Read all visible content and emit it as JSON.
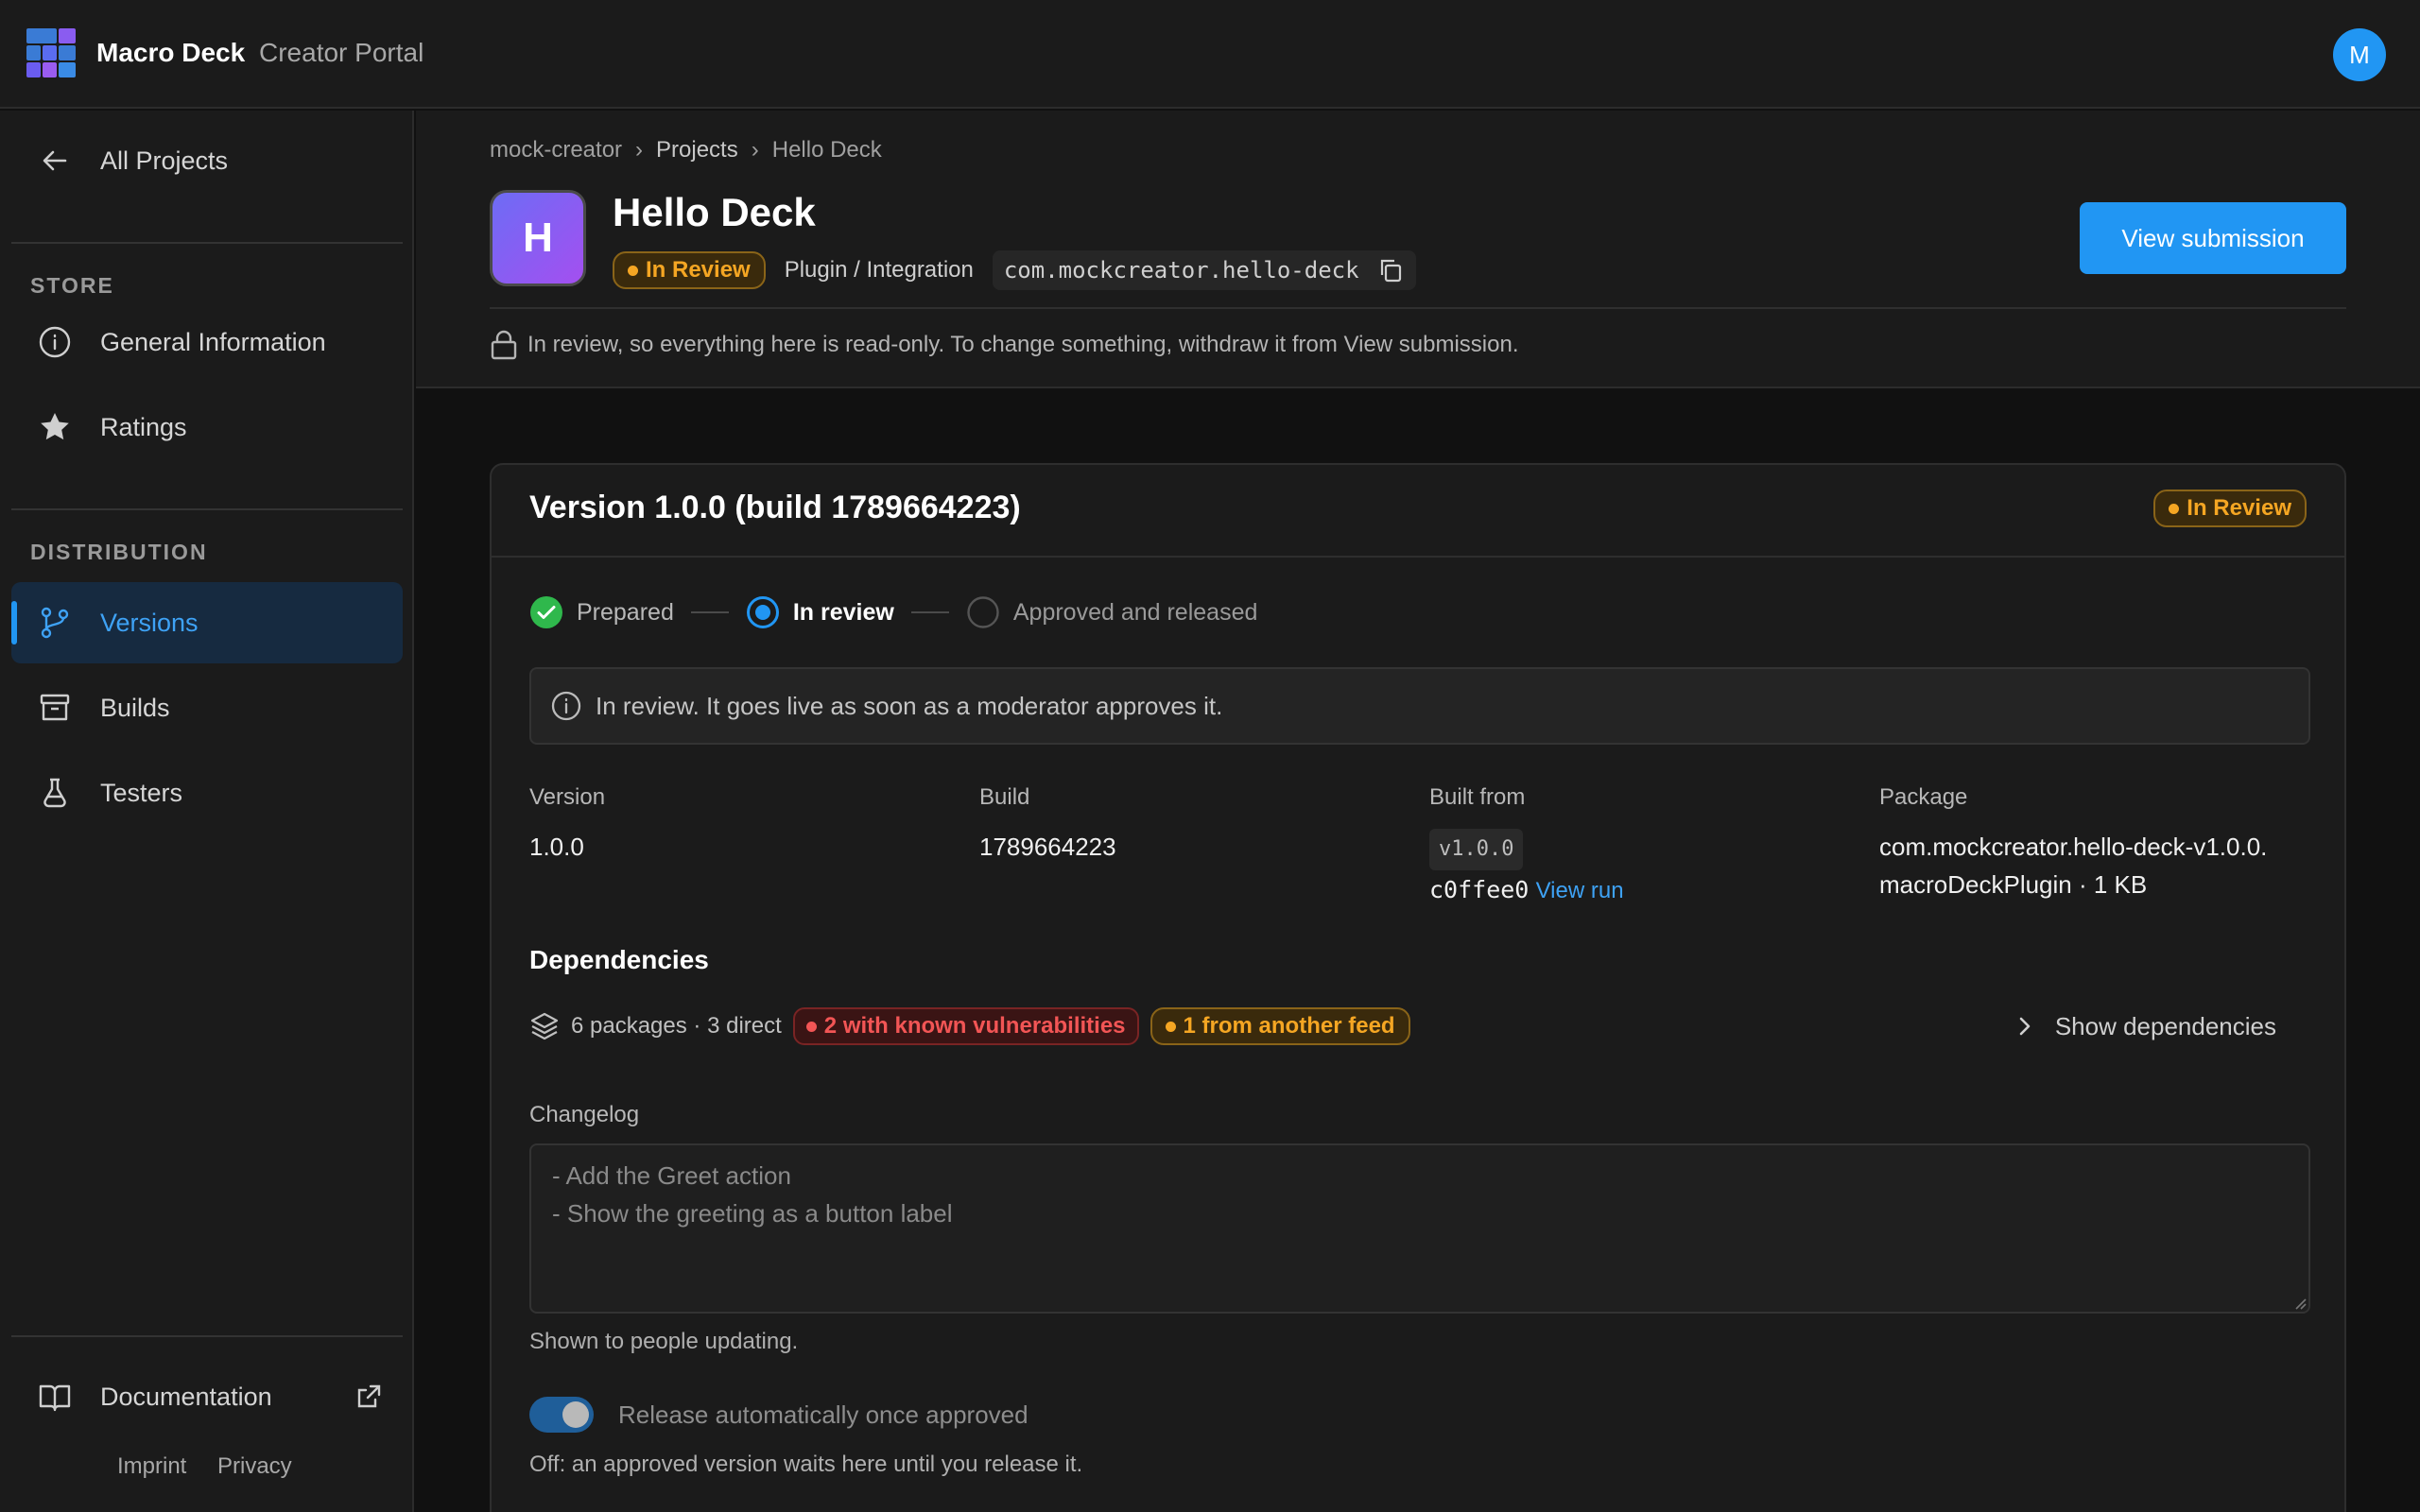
{
  "app": {
    "brand": "Macro Deck",
    "brand_sub": "Creator Portal",
    "avatar_initial": "M",
    "accent": "#2196f3"
  },
  "sidebar": {
    "back_label": "All Projects",
    "store_heading": "STORE",
    "store_items": [
      {
        "label": "General Information",
        "icon": "info-icon"
      },
      {
        "label": "Ratings",
        "icon": "star-icon"
      }
    ],
    "distribution_heading": "DISTRIBUTION",
    "distribution_items": [
      {
        "label": "Versions",
        "icon": "branch-icon",
        "active": true
      },
      {
        "label": "Builds",
        "icon": "archive-icon"
      },
      {
        "label": "Testers",
        "icon": "flask-icon"
      }
    ],
    "docs_label": "Documentation",
    "imprint": "Imprint",
    "privacy": "Privacy"
  },
  "breadcrumb": [
    "mock-creator",
    "Projects",
    "Hello Deck"
  ],
  "project": {
    "icon_letter": "H",
    "title": "Hello Deck",
    "status": "In Review",
    "category": "Plugin / Integration",
    "bundle_id": "com.mockcreator.hello-deck",
    "primary_action": "View submission",
    "readonly_note": "In review, so everything here is read-only. To change something, withdraw it from View submission."
  },
  "version_card": {
    "title": "Version 1.0.0 (build 1789664223)",
    "status": "In Review",
    "steps": [
      {
        "label": "Prepared",
        "state": "done"
      },
      {
        "label": "In review",
        "state": "current"
      },
      {
        "label": "Approved and released",
        "state": "pending"
      }
    ],
    "info": "In review. It goes live as soon as a moderator approves it.",
    "fields": {
      "version_label": "Version",
      "version_value": "1.0.0",
      "build_label": "Build",
      "build_value": "1789664223",
      "built_from_label": "Built from",
      "built_from_tag": "v1.0.0",
      "built_from_commit": "c0ffee0",
      "view_run": "View run",
      "package_label": "Package",
      "package_value": "com.mockcreator.hello-deck-v1.0.0.macroDeckPlugin · 1 KB"
    },
    "dependencies": {
      "title": "Dependencies",
      "summary": "6 packages · 3 direct",
      "vuln_badge": "2 with known vulnerabilities",
      "feed_badge": "1 from another feed",
      "show_label": "Show dependencies"
    },
    "changelog": {
      "label": "Changelog",
      "placeholder": "- Add the Greet action\n- Show the greeting as a button label",
      "hint": "Shown to people updating."
    },
    "auto_release": {
      "label": "Release automatically once approved",
      "hint": "Off: an approved version waits here until you release it."
    }
  }
}
